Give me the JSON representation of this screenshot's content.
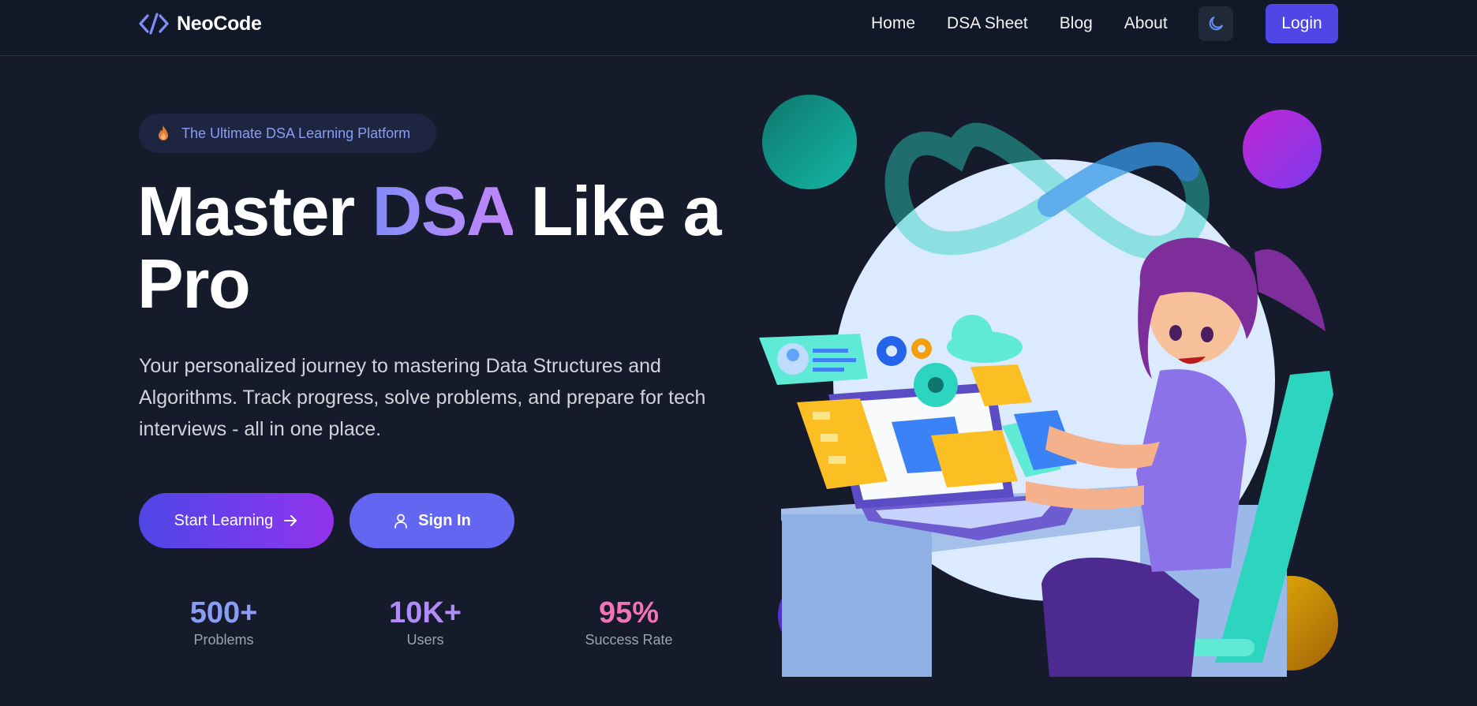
{
  "brand": {
    "name": "NeoCode",
    "logo_icon": "code-brackets-icon"
  },
  "nav": {
    "links": [
      "Home",
      "DSA Sheet",
      "Blog",
      "About"
    ],
    "theme_icon": "moon-icon",
    "login_label": "Login"
  },
  "hero": {
    "badge_icon": "fire-icon",
    "badge_text": "The Ultimate DSA Learning Platform",
    "title_before": "Master ",
    "title_accent": "DSA",
    "title_after": " Like a Pro",
    "description": "Your personalized journey to mastering Data Structures and Algorithms. Track progress, solve problems, and prepare for tech interviews - all in one place.",
    "primary_button": "Start Learning",
    "secondary_button": "Sign In"
  },
  "stats": [
    {
      "value": "500+",
      "label": "Problems",
      "color": "#8b9cf6"
    },
    {
      "value": "10K+",
      "label": "Users",
      "color": "#b08cf9"
    },
    {
      "value": "95%",
      "label": "Success Rate",
      "color": "#f472b6"
    }
  ],
  "colors": {
    "background": "#151b2b",
    "nav_background": "#111827",
    "accent": "#4f46e5",
    "accent_light": "#6366f1"
  }
}
